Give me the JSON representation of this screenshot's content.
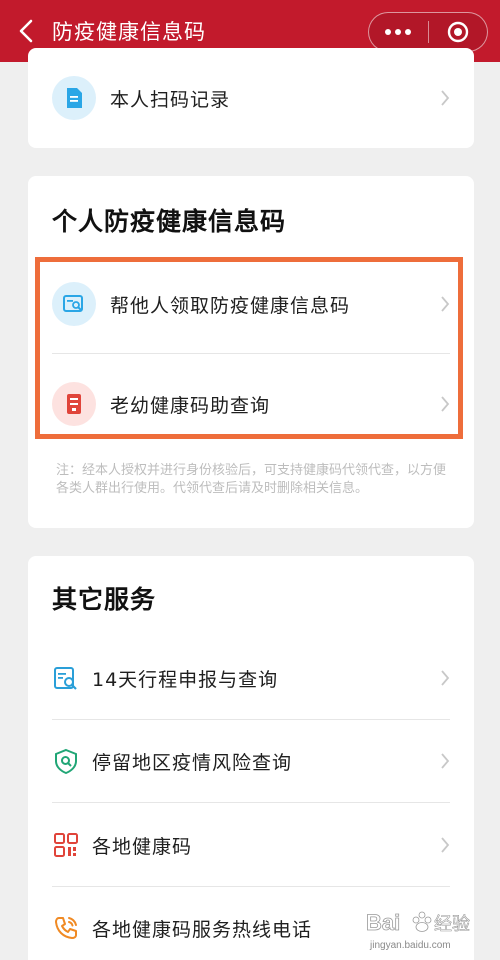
{
  "header": {
    "title": "防疫健康信息码",
    "bg_color": "#c21a2c"
  },
  "card1": {
    "items": [
      {
        "label": "本人扫码记录",
        "icon": "document-icon"
      }
    ]
  },
  "card2": {
    "title": "个人防疫健康信息码",
    "items": [
      {
        "label": "帮他人领取防疫健康信息码",
        "icon": "search-card-icon"
      },
      {
        "label": "老幼健康码助查询",
        "icon": "id-badge-icon"
      }
    ],
    "note": "注：经本人授权并进行身份核验后，可支持健康码代领代查，以方便各类人群出行使用。代领代查后请及时删除相关信息。",
    "highlight_color": "#ee6d3b"
  },
  "card3": {
    "title": "其它服务",
    "items": [
      {
        "label": "14天行程申报与查询",
        "icon": "itinerary-search-icon"
      },
      {
        "label": "停留地区疫情风险查询",
        "icon": "shield-search-icon"
      },
      {
        "label": "各地健康码",
        "icon": "qr-code-icon"
      },
      {
        "label": "各地健康码服务热线电话",
        "icon": "phone-icon"
      }
    ]
  },
  "watermark": {
    "brand": "Bai",
    "brand_cn": "经验",
    "url": "jingyan.baidu.com"
  }
}
